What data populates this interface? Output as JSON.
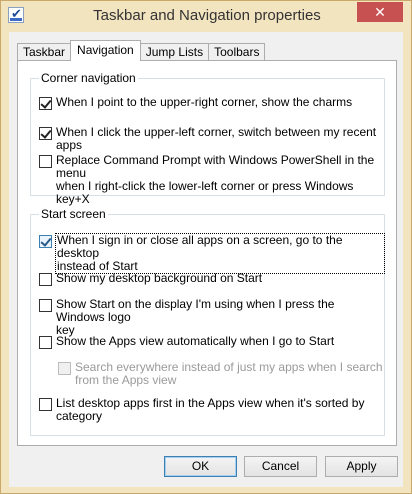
{
  "window": {
    "title": "Taskbar and Navigation properties",
    "close_label": "✕"
  },
  "tabs": [
    {
      "label": "Taskbar",
      "active": false
    },
    {
      "label": "Navigation",
      "active": true
    },
    {
      "label": "Jump Lists",
      "active": false
    },
    {
      "label": "Toolbars",
      "active": false
    }
  ],
  "corner_navigation": {
    "heading": "Corner navigation",
    "options": [
      {
        "label": "When I point to the upper-right corner, show the charms",
        "checked": true,
        "enabled": true
      },
      {
        "label": "When I click the upper-left corner, switch between my recent apps",
        "checked": true,
        "enabled": true
      },
      {
        "label_line1": "Replace Command Prompt with Windows PowerShell in the menu",
        "label_line2": "when I right-click the lower-left corner or press Windows key+X",
        "checked": false,
        "enabled": true
      }
    ]
  },
  "start_screen": {
    "heading": "Start screen",
    "options": [
      {
        "label_line1": "When I sign in or close all apps on a screen, go to the desktop",
        "label_line2": "instead of Start",
        "checked": true,
        "enabled": true,
        "focused": true
      },
      {
        "label": "Show my desktop background on Start",
        "checked": false,
        "enabled": true
      },
      {
        "label_line1": "Show Start on the display I'm using when I press the Windows logo",
        "label_line2": "key",
        "checked": false,
        "enabled": true
      },
      {
        "label": "Show the Apps view automatically when I go to Start",
        "checked": false,
        "enabled": true
      },
      {
        "label_line1": "Search everywhere instead of just my apps when I search",
        "label_line2": "from the Apps view",
        "checked": false,
        "enabled": false
      },
      {
        "label_line1": "List desktop apps first in the Apps view when it's sorted by",
        "label_line2": "category",
        "checked": false,
        "enabled": true
      }
    ]
  },
  "buttons": {
    "ok": "OK",
    "cancel": "Cancel",
    "apply": "Apply"
  }
}
